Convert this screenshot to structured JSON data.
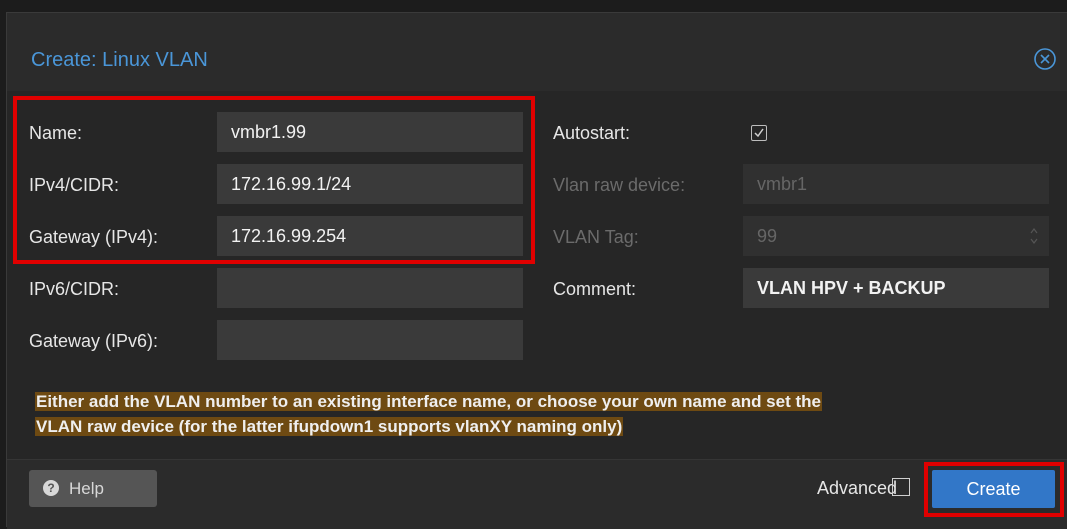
{
  "dialog": {
    "title": "Create: Linux VLAN",
    "close_icon": "close-circle-icon"
  },
  "form": {
    "name": {
      "label": "Name:",
      "value": "vmbr1.99"
    },
    "ipv4": {
      "label": "IPv4/CIDR:",
      "value": "172.16.99.1/24"
    },
    "gateway4": {
      "label": "Gateway (IPv4):",
      "value": "172.16.99.254"
    },
    "ipv6": {
      "label": "IPv6/CIDR:",
      "value": ""
    },
    "gateway6": {
      "label": "Gateway (IPv6):",
      "value": ""
    },
    "autostart": {
      "label": "Autostart:",
      "checked": true
    },
    "vlan_raw_device": {
      "label": "Vlan raw device:",
      "value": "vmbr1",
      "disabled": true
    },
    "vlan_tag": {
      "label": "VLAN Tag:",
      "value": "99",
      "disabled": true
    },
    "comment": {
      "label": "Comment:",
      "value": "VLAN HPV + BACKUP"
    }
  },
  "hint": {
    "line1": "Either add the VLAN number to an existing interface name, or choose your own name and set the",
    "line2": "VLAN raw device (for the latter ifupdown1 supports vlanXY naming only)"
  },
  "footer": {
    "help_label": "Help",
    "help_icon": "question-circle-icon",
    "advanced_label": "Advanced",
    "advanced_checked": false,
    "create_label": "Create"
  },
  "colors": {
    "accent": "#3277c8",
    "title": "#4a96d8",
    "highlight": "#e00000",
    "hint_bg": "#6e4a12"
  }
}
